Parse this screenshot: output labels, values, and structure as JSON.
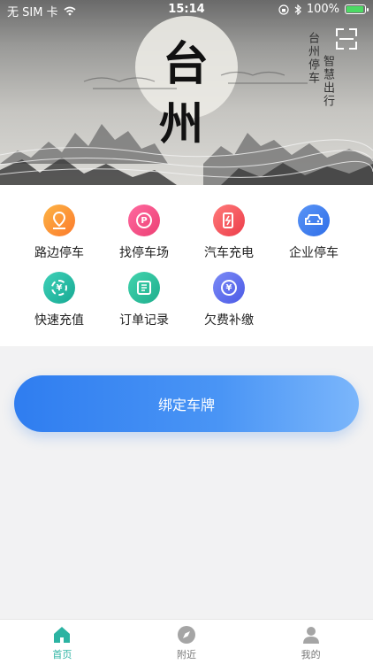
{
  "status_bar": {
    "carrier": "无 SIM 卡",
    "time": "15:14",
    "battery": "100%"
  },
  "banner": {
    "title_chars": [
      "台",
      "州"
    ],
    "side_text_1": "台州停车",
    "side_text_2": "智慧出行",
    "scan_icon": "scan-icon"
  },
  "menu": {
    "items": [
      {
        "label": "路边停车",
        "icon": "location-pin-icon",
        "color": "#fb8c35"
      },
      {
        "label": "找停车场",
        "icon": "parking-search-icon",
        "color": "#f04b82"
      },
      {
        "label": "汽车充电",
        "icon": "charging-station-icon",
        "color": "#f2545b"
      },
      {
        "label": "企业停车",
        "icon": "car-icon",
        "color": "#3d7ef0"
      },
      {
        "label": "快速充值",
        "icon": "recharge-icon",
        "color": "#26b8a4"
      },
      {
        "label": "订单记录",
        "icon": "order-list-icon",
        "color": "#2ec09f"
      },
      {
        "label": "欠费补缴",
        "icon": "arrears-payment-icon",
        "color": "#6070ee"
      }
    ]
  },
  "bind_button": {
    "label": "绑定车牌",
    "colors": [
      "#2f7df0",
      "#7bb6fb"
    ]
  },
  "tabbar": {
    "accent": "#2bb3a2",
    "tabs": [
      {
        "label": "首页",
        "icon": "home-icon",
        "active": true
      },
      {
        "label": "附近",
        "icon": "compass-icon",
        "active": false
      },
      {
        "label": "我的",
        "icon": "profile-icon",
        "active": false
      }
    ]
  }
}
